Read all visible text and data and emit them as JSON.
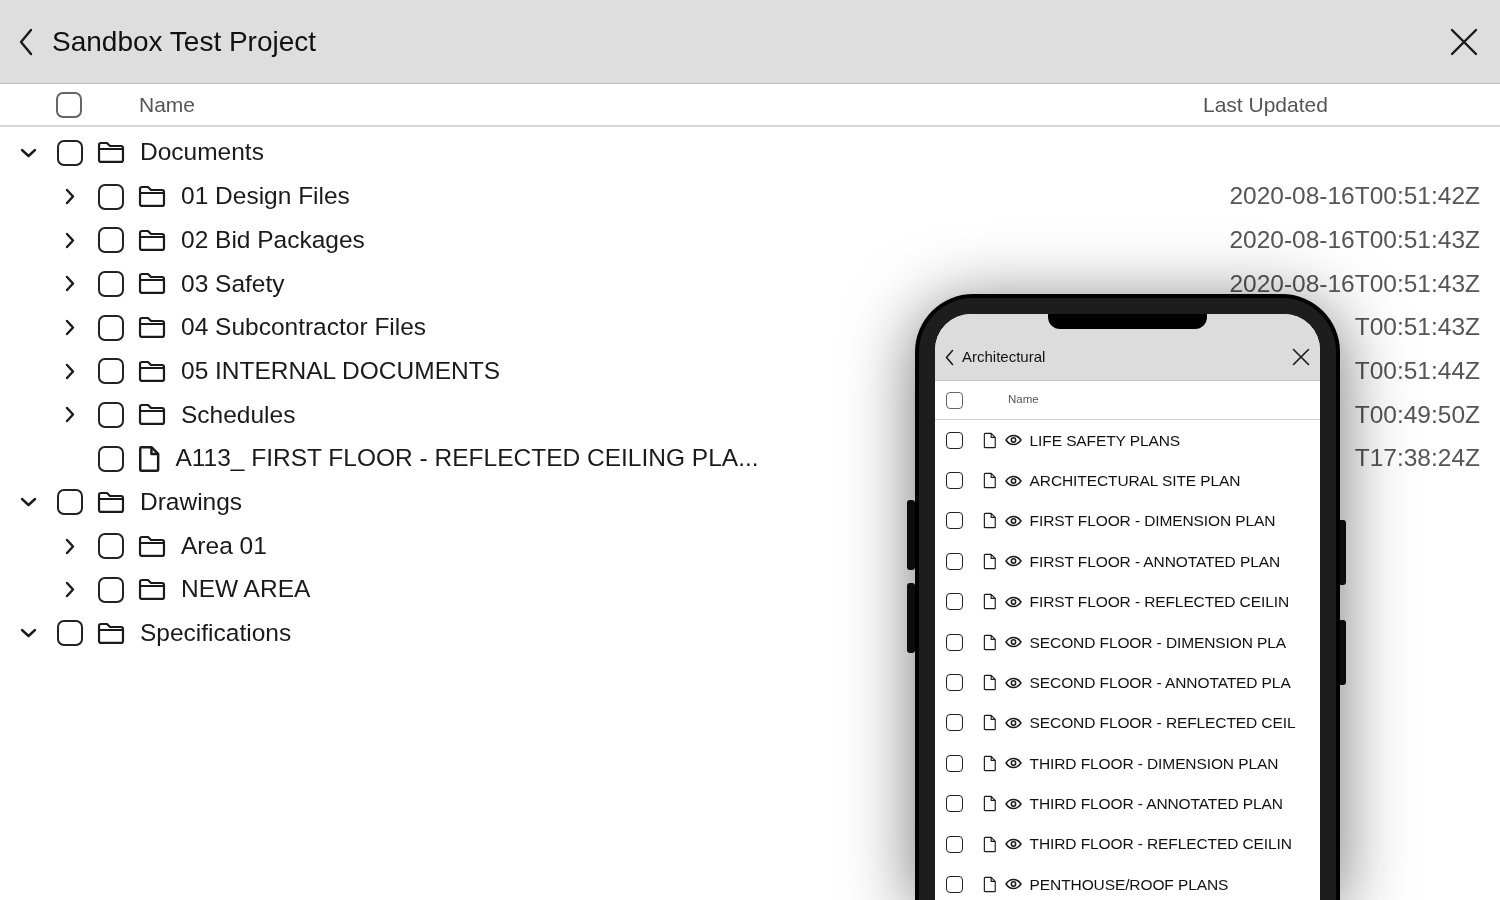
{
  "window": {
    "title": "Sandbox Test Project"
  },
  "columns": {
    "name": "Name",
    "updated": "Last Updated",
    "checked": false
  },
  "items": [
    {
      "kind": "folder",
      "name": "Documents",
      "checked": false,
      "expanded": true,
      "children": [
        {
          "kind": "folder",
          "name": "01 Design Files",
          "updated": "2020-08-16T00:51:42Z",
          "checked": false,
          "expanded": false
        },
        {
          "kind": "folder",
          "name": "02 Bid Packages",
          "updated": "2020-08-16T00:51:43Z",
          "checked": false,
          "expanded": false
        },
        {
          "kind": "folder",
          "name": "03 Safety",
          "updated": "2020-08-16T00:51:43Z",
          "checked": false,
          "expanded": false
        },
        {
          "kind": "folder",
          "name": "04 Subcontractor Files",
          "updated": "T00:51:43Z",
          "checked": false,
          "expanded": false
        },
        {
          "kind": "folder",
          "name": "05 INTERNAL DOCUMENTS",
          "updated": "T00:51:44Z",
          "checked": false,
          "expanded": false
        },
        {
          "kind": "folder",
          "name": "Schedules",
          "updated": "T00:49:50Z",
          "checked": false,
          "expanded": false
        },
        {
          "kind": "file",
          "name": "A113_ FIRST FLOOR - REFLECTED CEILING PLA...",
          "updated": "T17:38:24Z",
          "checked": false
        }
      ]
    },
    {
      "kind": "folder",
      "name": "Drawings",
      "checked": false,
      "expanded": true,
      "children": [
        {
          "kind": "folder",
          "name": "Area 01",
          "checked": false,
          "expanded": false
        },
        {
          "kind": "folder",
          "name": "NEW AREA",
          "checked": false,
          "expanded": false
        }
      ]
    },
    {
      "kind": "folder",
      "name": "Specifications",
      "checked": false,
      "expanded": true
    }
  ],
  "phone": {
    "title": "Architectural",
    "column": "Name",
    "checked": false,
    "rows": [
      {
        "name": "LIFE SAFETY PLANS",
        "checked": false
      },
      {
        "name": "ARCHITECTURAL SITE PLAN",
        "checked": false
      },
      {
        "name": "FIRST FLOOR - DIMENSION PLAN",
        "checked": false
      },
      {
        "name": "FIRST FLOOR - ANNOTATED PLAN",
        "checked": false
      },
      {
        "name": "FIRST FLOOR - REFLECTED CEILIN",
        "checked": false
      },
      {
        "name": "SECOND FLOOR - DIMENSION PLA",
        "checked": false
      },
      {
        "name": "SECOND FLOOR - ANNOTATED PLA",
        "checked": false
      },
      {
        "name": "SECOND FLOOR - REFLECTED CEIL",
        "checked": false
      },
      {
        "name": "THIRD FLOOR - DIMENSION PLAN",
        "checked": false
      },
      {
        "name": "THIRD FLOOR - ANNOTATED PLAN",
        "checked": false
      },
      {
        "name": "THIRD FLOOR - REFLECTED CEILIN",
        "checked": false
      },
      {
        "name": "PENTHOUSE/ROOF PLANS",
        "checked": false
      }
    ]
  }
}
